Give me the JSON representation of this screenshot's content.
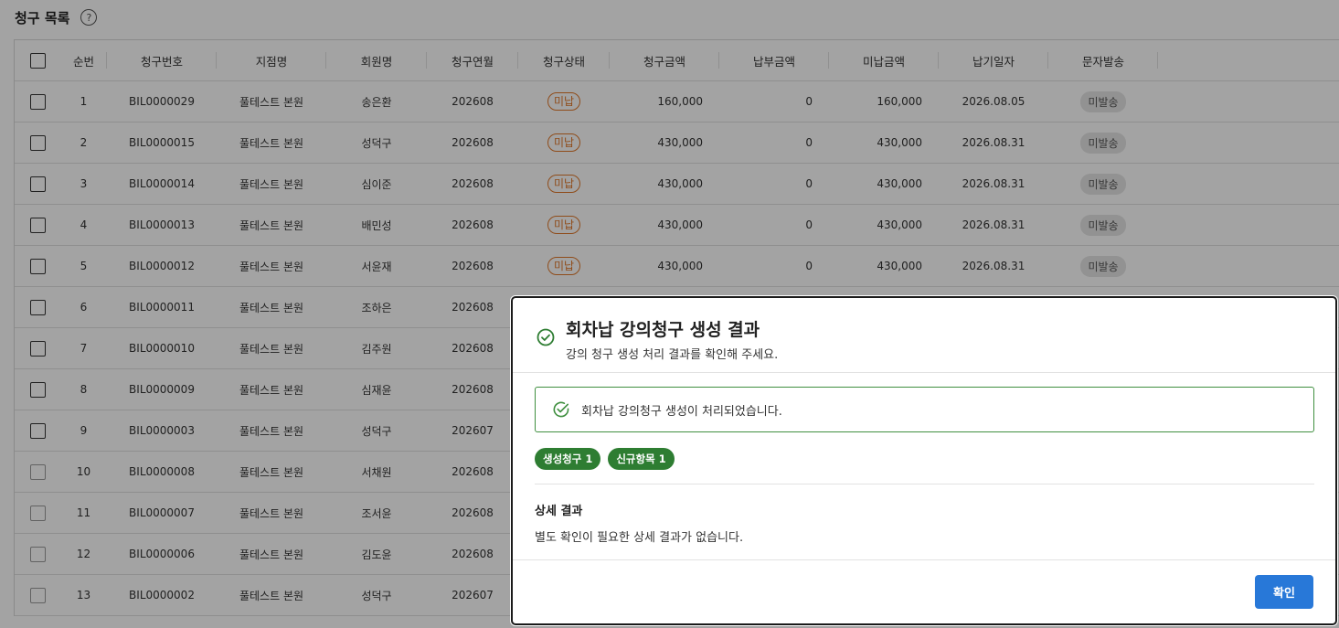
{
  "page": {
    "title": "청구 목록",
    "help_icon": "?"
  },
  "table": {
    "headers": {
      "no": "순번",
      "bill_no": "청구번호",
      "branch": "지점명",
      "member": "회원명",
      "bill_month": "청구연월",
      "status": "청구상태",
      "bill_amount": "청구금액",
      "paid_amount": "납부금액",
      "unpaid_amount": "미납금액",
      "due_date": "납기일자",
      "sms": "문자발송"
    },
    "rows": [
      {
        "no": "1",
        "bill_no": "BIL0000029",
        "branch": "풀테스트 본원",
        "member": "송은환",
        "bill_month": "202608",
        "status": "미납",
        "bill_amount": "160,000",
        "paid_amount": "0",
        "unpaid_amount": "160,000",
        "due_date": "2026.08.05",
        "sms": "미발송"
      },
      {
        "no": "2",
        "bill_no": "BIL0000015",
        "branch": "풀테스트 본원",
        "member": "성덕구",
        "bill_month": "202608",
        "status": "미납",
        "bill_amount": "430,000",
        "paid_amount": "0",
        "unpaid_amount": "430,000",
        "due_date": "2026.08.31",
        "sms": "미발송"
      },
      {
        "no": "3",
        "bill_no": "BIL0000014",
        "branch": "풀테스트 본원",
        "member": "심이준",
        "bill_month": "202608",
        "status": "미납",
        "bill_amount": "430,000",
        "paid_amount": "0",
        "unpaid_amount": "430,000",
        "due_date": "2026.08.31",
        "sms": "미발송"
      },
      {
        "no": "4",
        "bill_no": "BIL0000013",
        "branch": "풀테스트 본원",
        "member": "배민성",
        "bill_month": "202608",
        "status": "미납",
        "bill_amount": "430,000",
        "paid_amount": "0",
        "unpaid_amount": "430,000",
        "due_date": "2026.08.31",
        "sms": "미발송"
      },
      {
        "no": "5",
        "bill_no": "BIL0000012",
        "branch": "풀테스트 본원",
        "member": "서윤재",
        "bill_month": "202608",
        "status": "미납",
        "bill_amount": "430,000",
        "paid_amount": "0",
        "unpaid_amount": "430,000",
        "due_date": "2026.08.31",
        "sms": "미발송"
      },
      {
        "no": "6",
        "bill_no": "BIL0000011",
        "branch": "풀테스트 본원",
        "member": "조하은",
        "bill_month": "202608"
      },
      {
        "no": "7",
        "bill_no": "BIL0000010",
        "branch": "풀테스트 본원",
        "member": "김주원",
        "bill_month": "202608"
      },
      {
        "no": "8",
        "bill_no": "BIL0000009",
        "branch": "풀테스트 본원",
        "member": "심재윤",
        "bill_month": "202608"
      },
      {
        "no": "9",
        "bill_no": "BIL0000003",
        "branch": "풀테스트 본원",
        "member": "성덕구",
        "bill_month": "202607"
      },
      {
        "no": "10",
        "bill_no": "BIL0000008",
        "branch": "풀테스트 본원",
        "member": "서채원",
        "bill_month": "202608"
      },
      {
        "no": "11",
        "bill_no": "BIL0000007",
        "branch": "풀테스트 본원",
        "member": "조서윤",
        "bill_month": "202608"
      },
      {
        "no": "12",
        "bill_no": "BIL0000006",
        "branch": "풀테스트 본원",
        "member": "김도윤",
        "bill_month": "202608"
      },
      {
        "no": "13",
        "bill_no": "BIL0000002",
        "branch": "풀테스트 본원",
        "member": "성덕구",
        "bill_month": "202607"
      }
    ]
  },
  "modal": {
    "icon": "check-circle-icon",
    "title": "회차납 강의청구 생성 결과",
    "subtitle": "강의 청구 생성 처리 결과를 확인해 주세요.",
    "alert_text": "회차납 강의청구 생성이 처리되었습니다.",
    "pills": [
      "생성청구 1",
      "신규항목 1"
    ],
    "detail_title": "상세 결과",
    "detail_text": "별도 확인이 필요한 상세 결과가 없습니다.",
    "confirm_label": "확인"
  },
  "colors": {
    "accent_blue": "#2878d8",
    "success_green": "#2e7d32",
    "status_orange": "#e0782a"
  }
}
